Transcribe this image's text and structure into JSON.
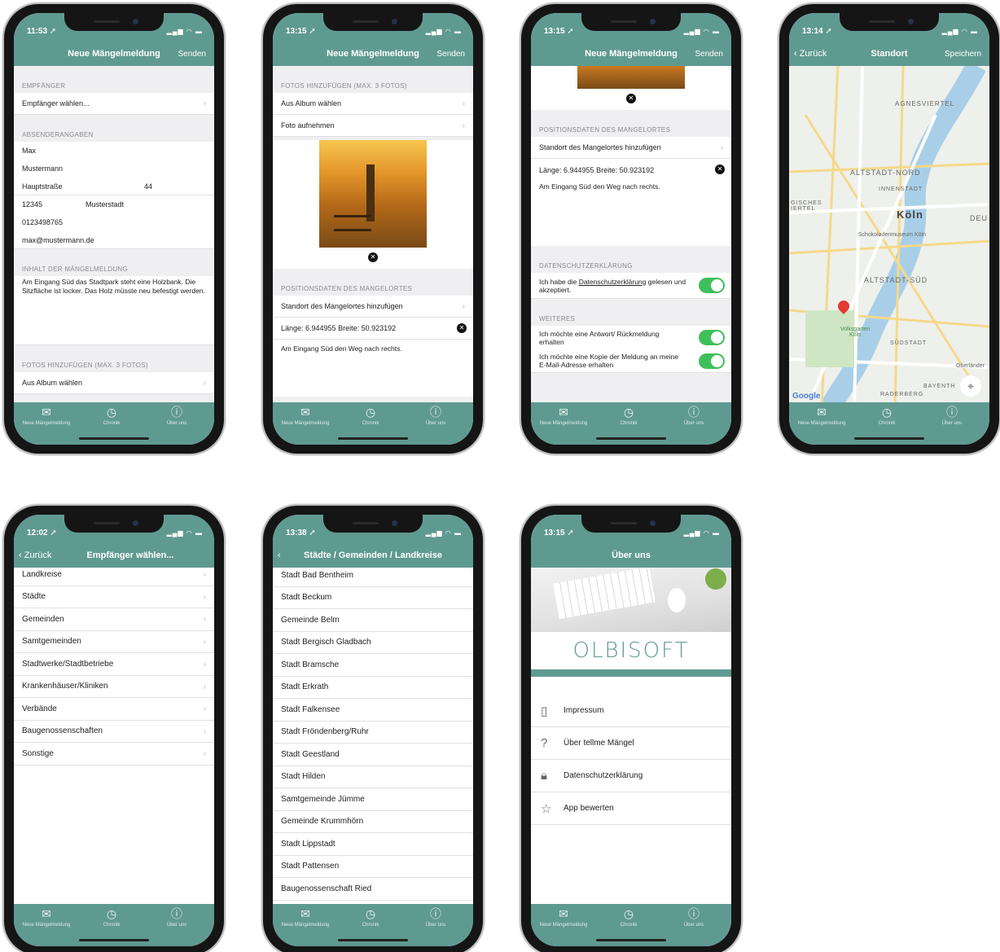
{
  "brand": {
    "teal": "#5f9a91",
    "toggle": "#3fbf5a"
  },
  "tabs": [
    "Neue Mängelmeldung",
    "Chronik",
    "Über uns"
  ],
  "tab_icons": [
    "mail-icon",
    "chronik-icon",
    "info-icon"
  ],
  "s1": {
    "time": "11:53 ➚",
    "title": "Neue Mängelmeldung",
    "send": "Senden",
    "sec_empf": "EMPFÄNGER",
    "empf": "Empfänger wählen...",
    "sec_abs": "ABSENDERANGABEN",
    "vorname": "Max",
    "nachname": "Mustermann",
    "strasse": "Hauptstraße",
    "nr": "44",
    "plz": "12345",
    "ort": "Musterstadt",
    "tel": "0123498765",
    "mail": "max@mustermann.de",
    "sec_inhalt": "INHALT DER MÄNGELMELDUNG",
    "inhalt": "Am Eingang Süd das Stadtpark steht eine Holzbank. Die Sitzfläche ist locker. Das Holz müsste neu befestigt werden.",
    "sec_fotos": "FOTOS HINZUFÜGEN (MAX. 3 FOTOS)",
    "album": "Aus Album wählen"
  },
  "s2": {
    "time": "13:15 ➚",
    "title": "Neue Mängelmeldung",
    "send": "Senden",
    "sec_fotos": "FOTOS HINZUFÜGEN (MAX. 3 FOTOS)",
    "album": "Aus Album wählen",
    "foto": "Foto aufnehmen",
    "sec_pos": "POSITIONSDATEN DES MANGELORTES",
    "standort": "Standort des Mangelortes hinzufügen",
    "coords": "Länge: 6.944955 Breite: 50.923192",
    "hint": "Am Eingang Süd den Weg nach rechts."
  },
  "s3": {
    "time": "13:15 ➚",
    "title": "Neue Mängelmeldung",
    "send": "Senden",
    "sec_pos": "POSITIONSDATEN DES MANGELORTES",
    "standort": "Standort des Mangelortes hinzufügen",
    "coords": "Länge: 6.944955 Breite: 50.923192",
    "hint": "Am Eingang Süd den Weg nach rechts.",
    "sec_ds": "DATENSCHUTZERKLÄRUNG",
    "ds_a": "Ich habe die ",
    "ds_link": "Datenschutzerklärung",
    "ds_b": " gelesen und akzeptiert.",
    "sec_weiteres": "WEITERES",
    "opt1": "Ich möchte eine Antwort/ Rückmeldung erhalten",
    "opt2": "Ich möchte eine Kopie der Meldung an meine E-Mail-Adresse erhalten"
  },
  "s4": {
    "time": "13:14 ➚",
    "back": "Zurück",
    "title": "Standort",
    "save": "Speichern",
    "labels": [
      "AGNESVIERTEL",
      "ALTSTADT-NORD",
      "INNENSTADT",
      "Köln",
      "ALTSTADT-SÜD",
      "SÜDSTADT",
      "Volksgarten Köln",
      "Schokoladenmuseum Köln",
      "RADERBERG",
      "BAYENTH",
      "Oberländer",
      "DEU",
      "GISCHES IERTEL",
      "Google"
    ]
  },
  "s5": {
    "time": "12:02 ➚",
    "back": "Zurück",
    "title": "Empfänger wählen...",
    "items": [
      "Landkreise",
      "Städte",
      "Gemeinden",
      "Samtgemeinden",
      "Stadtwerke/Stadtbetriebe",
      "Krankenhäuser/Kliniken",
      "Verbände",
      "Baugenossenschaften",
      "Sonstige"
    ]
  },
  "s6": {
    "time": "13:38 ➚",
    "title": "Städte / Gemeinden / Landkreise",
    "items": [
      "Stadt Bad Bentheim",
      "Stadt Beckum",
      "Gemeinde Belm",
      "Stadt Bergisch Gladbach",
      "Stadt Bramsche",
      "Stadt Erkrath",
      "Stadt Falkensee",
      "Stadt Fröndenberg/Ruhr",
      "Stadt Geestland",
      "Stadt Hilden",
      "Samtgemeinde Jümme",
      "Gemeinde Krummhörn",
      "Stadt Lippstadt",
      "Stadt Pattensen",
      "Baugenossenschaft Ried"
    ]
  },
  "s7": {
    "time": "13:15 ➚",
    "title": "Über uns",
    "logo": "OLBISOFT",
    "items": [
      "Impressum",
      "Über tellme Mängel",
      "Datenschutzerklärung",
      "App bewerten"
    ]
  }
}
